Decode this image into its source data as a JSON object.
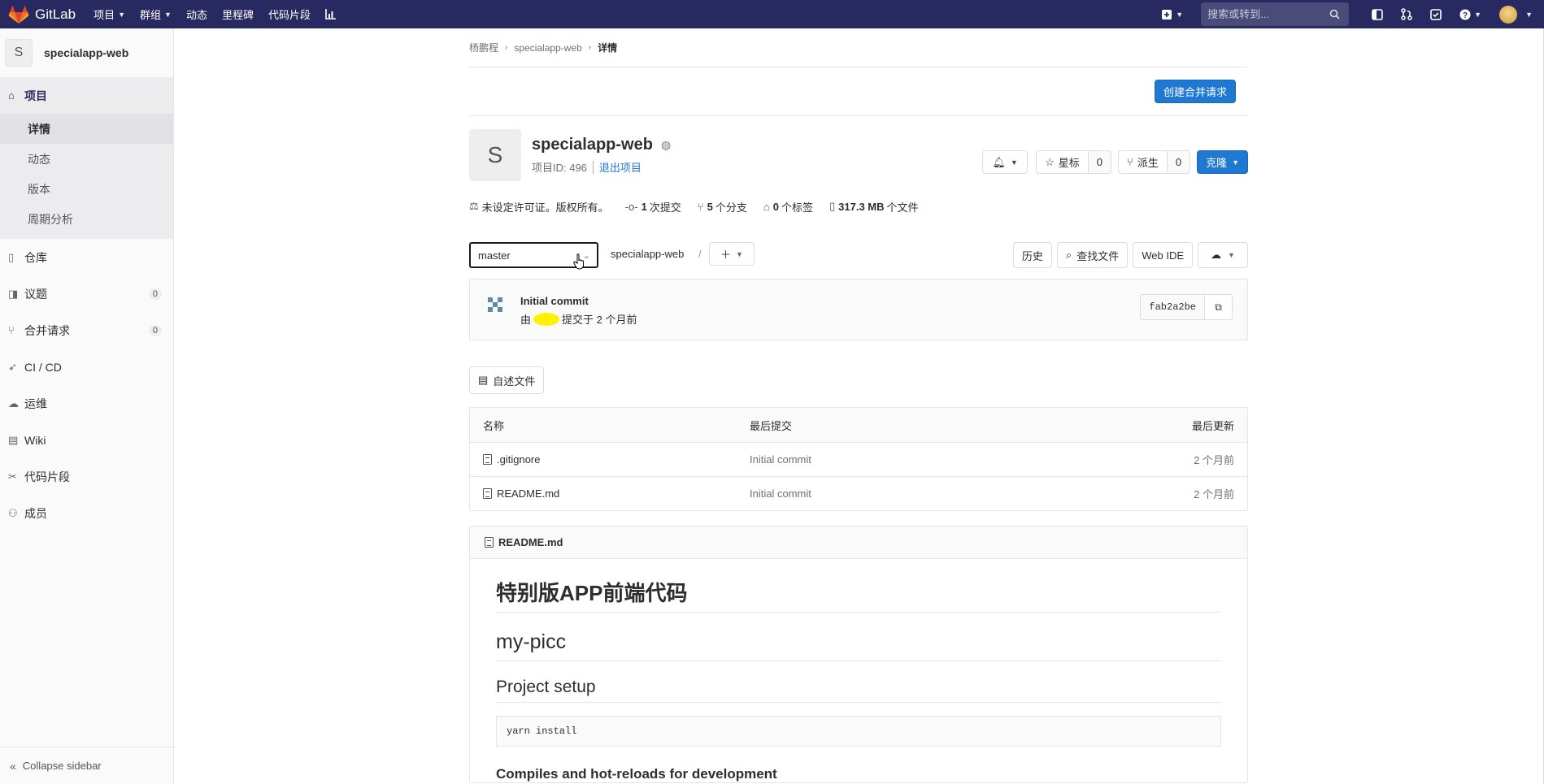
{
  "topnav": {
    "brand": "GitLab",
    "items": [
      {
        "label": "项目",
        "dropdown": true
      },
      {
        "label": "群组",
        "dropdown": true
      },
      {
        "label": "动态",
        "dropdown": false
      },
      {
        "label": "里程碑",
        "dropdown": false
      },
      {
        "label": "代码片段",
        "dropdown": false
      }
    ],
    "search_placeholder": "搜索或转到..."
  },
  "sidebar": {
    "project_initial": "S",
    "project_name": "specialapp-web",
    "section_project": "项目",
    "sub_items": [
      "详情",
      "动态",
      "版本",
      "周期分析"
    ],
    "items": [
      {
        "label": "仓库",
        "count": null
      },
      {
        "label": "议题",
        "count": "0"
      },
      {
        "label": "合并请求",
        "count": "0"
      },
      {
        "label": "CI / CD",
        "count": null
      },
      {
        "label": "运维",
        "count": null
      },
      {
        "label": "Wiki",
        "count": null
      },
      {
        "label": "代码片段",
        "count": null
      },
      {
        "label": "成员",
        "count": null
      }
    ],
    "collapse": "Collapse sidebar"
  },
  "breadcrumb": [
    "杨鹏程",
    "specialapp-web",
    "详情"
  ],
  "create_mr": "创建合并请求",
  "project": {
    "initial": "S",
    "name": "specialapp-web",
    "id_label": "项目ID: 496",
    "leave": "退出项目",
    "star_label": "星标",
    "star_count": "0",
    "fork_label": "派生",
    "fork_count": "0",
    "clone_label": "克隆"
  },
  "stats": {
    "license": "未设定许可证。版权所有。",
    "commits_num": "1",
    "commits_label": "次提交",
    "branches_num": "5",
    "branches_label": "个分支",
    "tags_num": "0",
    "tags_label": "个标签",
    "files_num": "317.3 MB",
    "files_label": "个文件"
  },
  "tree": {
    "branch": "master",
    "path": "specialapp-web",
    "sep": "/",
    "history": "历史",
    "find": "查找文件",
    "webide": "Web IDE"
  },
  "commit": {
    "title": "Initial commit",
    "by": "由",
    "rest": "提交于 2 个月前",
    "sha": "fab2a2be"
  },
  "readme_button": "自述文件",
  "table": {
    "headers": [
      "名称",
      "最后提交",
      "最后更新"
    ],
    "rows": [
      {
        "name": ".gitignore",
        "commit": "Initial commit",
        "updated": "2 个月前"
      },
      {
        "name": "README.md",
        "commit": "Initial commit",
        "updated": "2 个月前"
      }
    ]
  },
  "readme": {
    "file": "README.md",
    "h1": "特别版APP前端代码",
    "h1b": "my-picc",
    "h2": "Project setup",
    "code": "yarn install",
    "h3": "Compiles and hot-reloads for development"
  },
  "colors": {
    "nav": "#292961",
    "primary": "#1f78d1",
    "highlight": "#fff200"
  }
}
